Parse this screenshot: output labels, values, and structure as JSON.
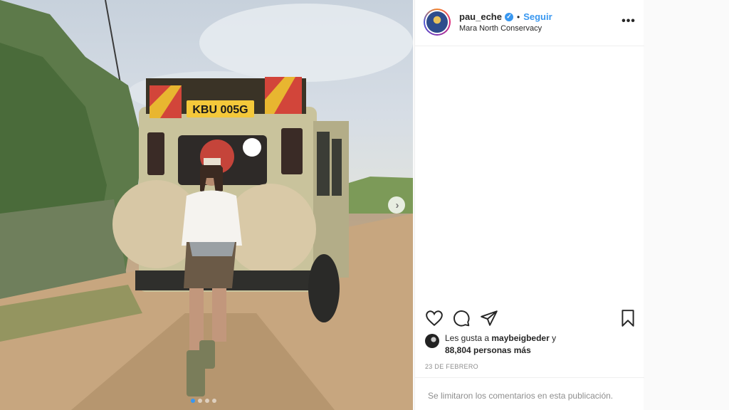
{
  "post": {
    "photo_alt": "",
    "carousel_dots": 4,
    "active_dot": 1,
    "plate_text": "KBU 005G",
    "next_icon": "chevron-right-icon"
  },
  "header": {
    "username": "pau_eche",
    "verified_icon": "verified-badge-icon",
    "bullet": "•",
    "follow_label": "Seguir",
    "location": "Mara North Conservacy",
    "more_label": "•••"
  },
  "actions": {
    "icons": [
      "heart-icon",
      "comment-icon",
      "share-icon",
      "bookmark-icon"
    ]
  },
  "likes": {
    "prefix": "Les gusta a ",
    "user": "maybeigbeder",
    "suffix": " y",
    "count_text": "88,804 personas más"
  },
  "date": "23 de febrero",
  "comments_notice": "Se limitaron los comentarios en esta publicación.",
  "colors": {
    "accent": "#3897f0",
    "text": "#262626",
    "muted": "#8e8e8e",
    "border": "#efefef"
  }
}
